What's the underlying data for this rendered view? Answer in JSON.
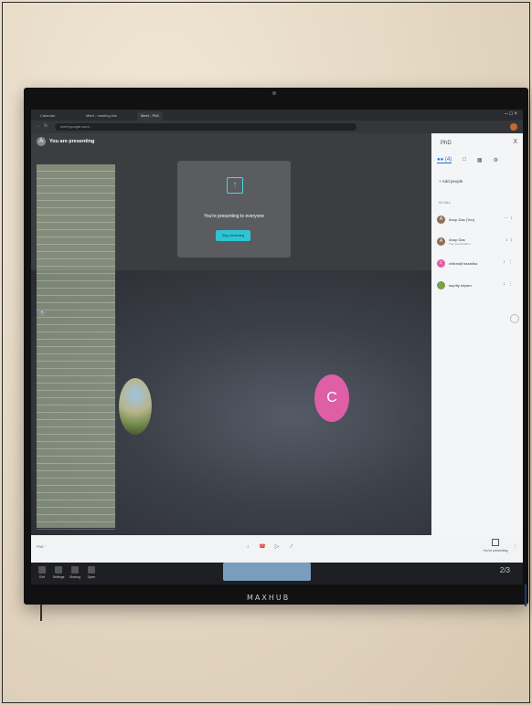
{
  "browser": {
    "tabs": [
      "Calendar",
      "Meet - meeting link",
      "Meet - PhD"
    ],
    "url": "meet.google.com/..."
  },
  "meet": {
    "presenter_initial": "A",
    "presenting_header": "You are presenting",
    "share_card": {
      "title": "You're presenting to everyone",
      "stop_button": "Stop presenting"
    },
    "avatar_initial": "C",
    "tile_names": [
      "suprity shyam",
      "chitranjit hazarika"
    ],
    "sheet_rows": [
      "",
      "",
      "",
      "",
      "",
      "",
      "",
      "",
      "",
      "",
      "",
      "",
      "",
      "",
      "",
      "",
      "",
      "",
      "",
      "",
      "",
      "",
      "",
      "",
      "",
      "",
      "",
      "",
      "",
      "",
      "",
      "",
      "",
      "",
      "",
      "",
      "",
      "",
      "",
      "",
      "",
      "",
      "",
      "",
      "",
      "",
      "",
      "",
      "",
      "",
      "",
      "",
      ""
    ]
  },
  "panel": {
    "title": "PhD",
    "close": "X",
    "tab_people_count": "(4)",
    "add_people": "Add people",
    "section": "IN CALL",
    "people": [
      {
        "initial": "A",
        "name": "Anup Das (You)",
        "sub": "",
        "color": "#8a6f5a"
      },
      {
        "initial": "A",
        "name": "Anup Das",
        "sub": "Your presentation",
        "color": "#8a6f5a"
      },
      {
        "initial": "c",
        "name": "chitranjit hazarika",
        "sub": "",
        "color": "#de5fa6"
      },
      {
        "initial": "",
        "name": "suprity shyam",
        "sub": "",
        "color": "#7aa04a"
      }
    ]
  },
  "bottom_bar": {
    "meeting_label": "PhD",
    "presenting_label": "You're presenting"
  },
  "taskbar": {
    "items": [
      "Exit",
      "Settings",
      "Sharing",
      "Open"
    ],
    "page": "2/3"
  },
  "tv_brand": "MAXHUB",
  "colors": {
    "accent": "#2fc4d4",
    "avatar_pink": "#de5fa6",
    "mic_off_red": "#e84b3c"
  }
}
